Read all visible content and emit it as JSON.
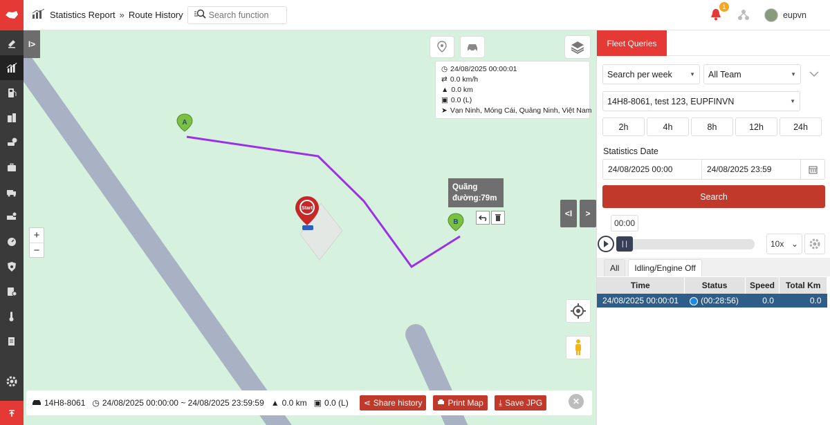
{
  "header": {
    "breadcrumb": [
      "Statistics Report",
      "Route History"
    ],
    "breadcrumb_sep": "»",
    "search_placeholder": "Search function",
    "notification_count": "1",
    "username": "eupvn"
  },
  "sidebar": {
    "icons": [
      "rubber-icon",
      "bar-chart-icon",
      "fuel-icon",
      "buildings-icon",
      "car-chat-icon",
      "briefcase-icon",
      "truck-icon",
      "truck-alert-icon",
      "speedometer-icon",
      "shield-icon",
      "route-doc-icon",
      "thermometer-icon",
      "report-icon",
      "settings-icon"
    ],
    "active_index": 1
  },
  "map": {
    "info": {
      "time": "24/08/2025 00:00:01",
      "speed": "0.0 km/h",
      "distance": "0.0 km",
      "fuel": "0.0 (L)",
      "address": "Vạn Ninh, Móng Cái, Quảng Ninh, Việt Nam"
    },
    "tooltip_lines": [
      "Quãng",
      "đường:79m"
    ],
    "marker_a": "A",
    "marker_b": "B",
    "start_label": "Start",
    "zoom_in": "+",
    "zoom_out": "−",
    "route_color": "#9b30e8"
  },
  "bottom_bar": {
    "plate": "14H8-8061",
    "time_range": "24/08/2025 00:00:00 ~ 24/08/2025 23:59:59",
    "distance": "0.0 km",
    "fuel": "0.0 (L)",
    "share_label": "Share history",
    "print_label": "Print Map",
    "save_label": "Save JPG"
  },
  "right_panel": {
    "tab_label": "Fleet Queries",
    "period_select": "Search per week",
    "team_select": "All Team",
    "vehicle_select": "14H8-8061, test 123, EUPFINVN",
    "hour_buttons": [
      "2h",
      "4h",
      "8h",
      "12h",
      "24h"
    ],
    "stats_date_label": "Statistics Date",
    "date_from": "24/08/2025 00:00",
    "date_to": "24/08/2025 23:59",
    "search_label": "Search",
    "player_time": "00:00",
    "playback_speed": "10x",
    "filter_tabs": [
      "All",
      "Idling/Engine Off"
    ],
    "table": {
      "headers": [
        "Time",
        "Status",
        "Speed",
        "Total Km"
      ],
      "rows": [
        {
          "time": "24/08/2025 00:00:01",
          "status": "(00:28:56)",
          "speed": "0.0",
          "total_km": "0.0"
        }
      ]
    }
  },
  "colors": {
    "brand_red": "#e53935",
    "button_red": "#c0392b",
    "map_bg": "#d6f2de",
    "road": "#a8b2c4",
    "selected_row": "#2f5d8a"
  }
}
